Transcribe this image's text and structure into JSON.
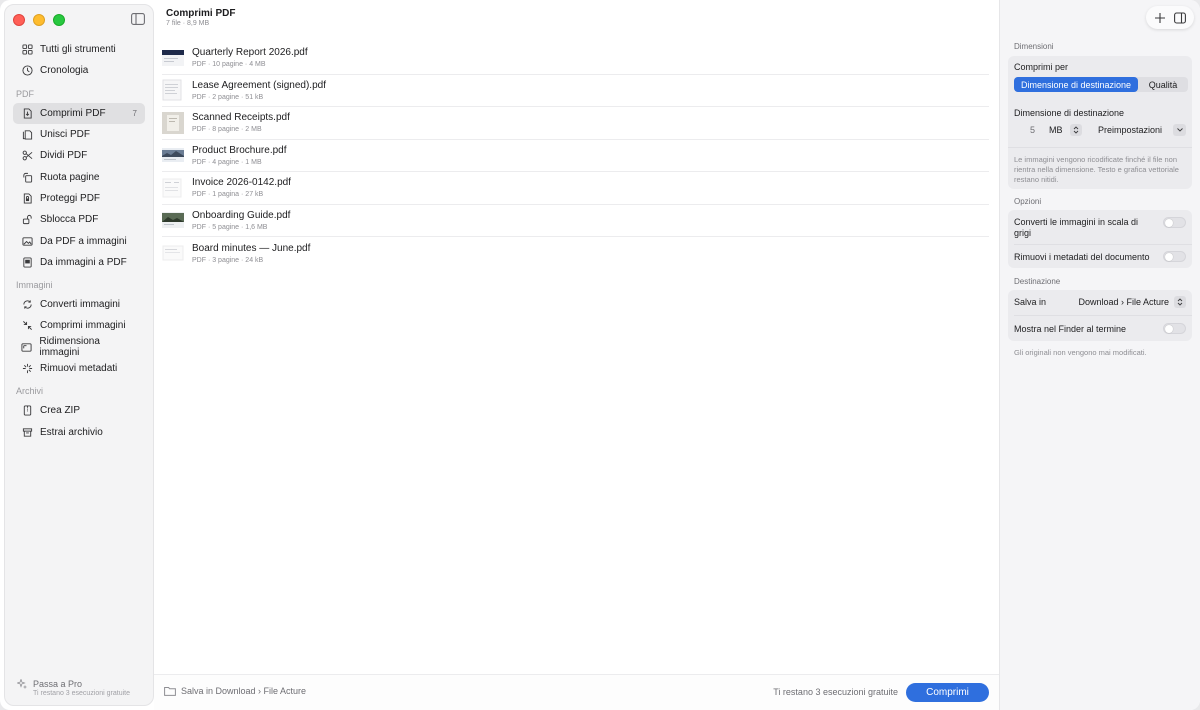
{
  "sidebar": {
    "groups": [
      {
        "title": "",
        "items": [
          {
            "label": "Tutti gli strumenti",
            "icon": "grid-icon"
          },
          {
            "label": "Cronologia",
            "icon": "clock-icon"
          }
        ]
      },
      {
        "title": "PDF",
        "items": [
          {
            "label": "Comprimi PDF",
            "icon": "compress-doc-icon",
            "count": "7",
            "active": true
          },
          {
            "label": "Unisci PDF",
            "icon": "merge-doc-icon"
          },
          {
            "label": "Dividi PDF",
            "icon": "scissors-icon"
          },
          {
            "label": "Ruota pagine",
            "icon": "rotate-icon"
          },
          {
            "label": "Proteggi PDF",
            "icon": "lock-doc-icon"
          },
          {
            "label": "Sblocca PDF",
            "icon": "unlock-icon"
          },
          {
            "label": "Da PDF a immagini",
            "icon": "image-icon"
          },
          {
            "label": "Da immagini a PDF",
            "icon": "image-doc-icon"
          }
        ]
      },
      {
        "title": "Immagini",
        "items": [
          {
            "label": "Converti immagini",
            "icon": "convert-icon"
          },
          {
            "label": "Comprimi immagini",
            "icon": "shrink-icon"
          },
          {
            "label": "Ridimensiona immagini",
            "icon": "resize-icon"
          },
          {
            "label": "Rimuovi metadati",
            "icon": "sparkle-off-icon"
          }
        ]
      },
      {
        "title": "Archivi",
        "items": [
          {
            "label": "Crea ZIP",
            "icon": "zip-icon"
          },
          {
            "label": "Estrai archivio",
            "icon": "archive-icon"
          }
        ]
      }
    ],
    "upgrade": {
      "label": "Passa a Pro",
      "sub": "Ti restano 3 esecuzioni gratuite"
    }
  },
  "main": {
    "title": "Comprimi PDF",
    "subtitle": "7 file · 8,9 MB",
    "files": [
      {
        "name": "Quarterly Report 2026.pdf",
        "meta": "PDF · 10 pagine · 4 MB",
        "thumb": "report"
      },
      {
        "name": "Lease Agreement (signed).pdf",
        "meta": "PDF · 2 pagine · 51 kB",
        "thumb": "doc"
      },
      {
        "name": "Scanned Receipts.pdf",
        "meta": "PDF · 8 pagine · 2 MB",
        "thumb": "scan"
      },
      {
        "name": "Product Brochure.pdf",
        "meta": "PDF · 4 pagine · 1 MB",
        "thumb": "photo"
      },
      {
        "name": "Invoice 2026-0142.pdf",
        "meta": "PDF · 1 pagina · 27 kB",
        "thumb": "doc"
      },
      {
        "name": "Onboarding Guide.pdf",
        "meta": "PDF · 5 pagine · 1,6 MB",
        "thumb": "photo2"
      },
      {
        "name": "Board minutes — June.pdf",
        "meta": "PDF · 3 pagine · 24 kB",
        "thumb": "doc"
      }
    ],
    "footer": {
      "destination": "Salva in Download › File Acture",
      "remaining": "Ti restano 3 esecuzioni gratuite",
      "action": "Comprimi"
    }
  },
  "inspector": {
    "dimensions": {
      "title": "Dimensioni",
      "compress_by": "Comprimi per",
      "seg_on": "Dimensione di destinazione",
      "seg_off": "Qualità",
      "target_label": "Dimensione di destinazione",
      "value": "5",
      "unit": "MB",
      "preset": "Preimpostazioni",
      "note": "Le immagini vengono ricodificate finché il file non rientra nella dimensione. Testo e grafica vettoriale restano nitidi."
    },
    "options": {
      "title": "Opzioni",
      "grayscale": "Converti le immagini in scala di grigi",
      "strip_meta": "Rimuovi i metadati del documento"
    },
    "destination": {
      "title": "Destinazione",
      "save_in": "Salva in",
      "save_value": "Download › File Acture",
      "show_finder": "Mostra nel Finder al termine",
      "footnote": "Gli originali non vengono mai modificati."
    }
  }
}
